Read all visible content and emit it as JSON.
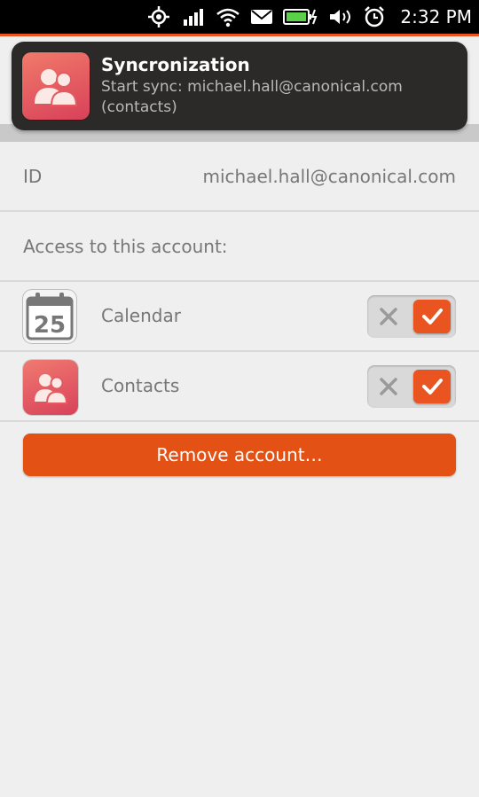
{
  "status_bar": {
    "time": "2:32 PM",
    "icons": [
      "location-icon",
      "signal-icon",
      "wifi-icon",
      "mail-icon",
      "battery-charging-icon",
      "volume-icon",
      "alarm-icon"
    ]
  },
  "notification": {
    "title": "Syncronization",
    "body_line1": "Start sync:  michael.hall@canonical.com",
    "body_line2": "(contacts)"
  },
  "account": {
    "id_label": "ID",
    "id_value": "michael.hall@canonical.com",
    "access_label": "Access to this account:"
  },
  "apps": [
    {
      "name": "Calendar",
      "icon": "calendar-icon",
      "calendar_day": "25",
      "enabled": true
    },
    {
      "name": "Contacts",
      "icon": "contacts-icon",
      "enabled": true
    }
  ],
  "remove_button": "Remove account…",
  "colors": {
    "accent": "#e95420",
    "status_bar": "#000000",
    "notification_bg": "#2b2a28",
    "background": "#efefef"
  }
}
